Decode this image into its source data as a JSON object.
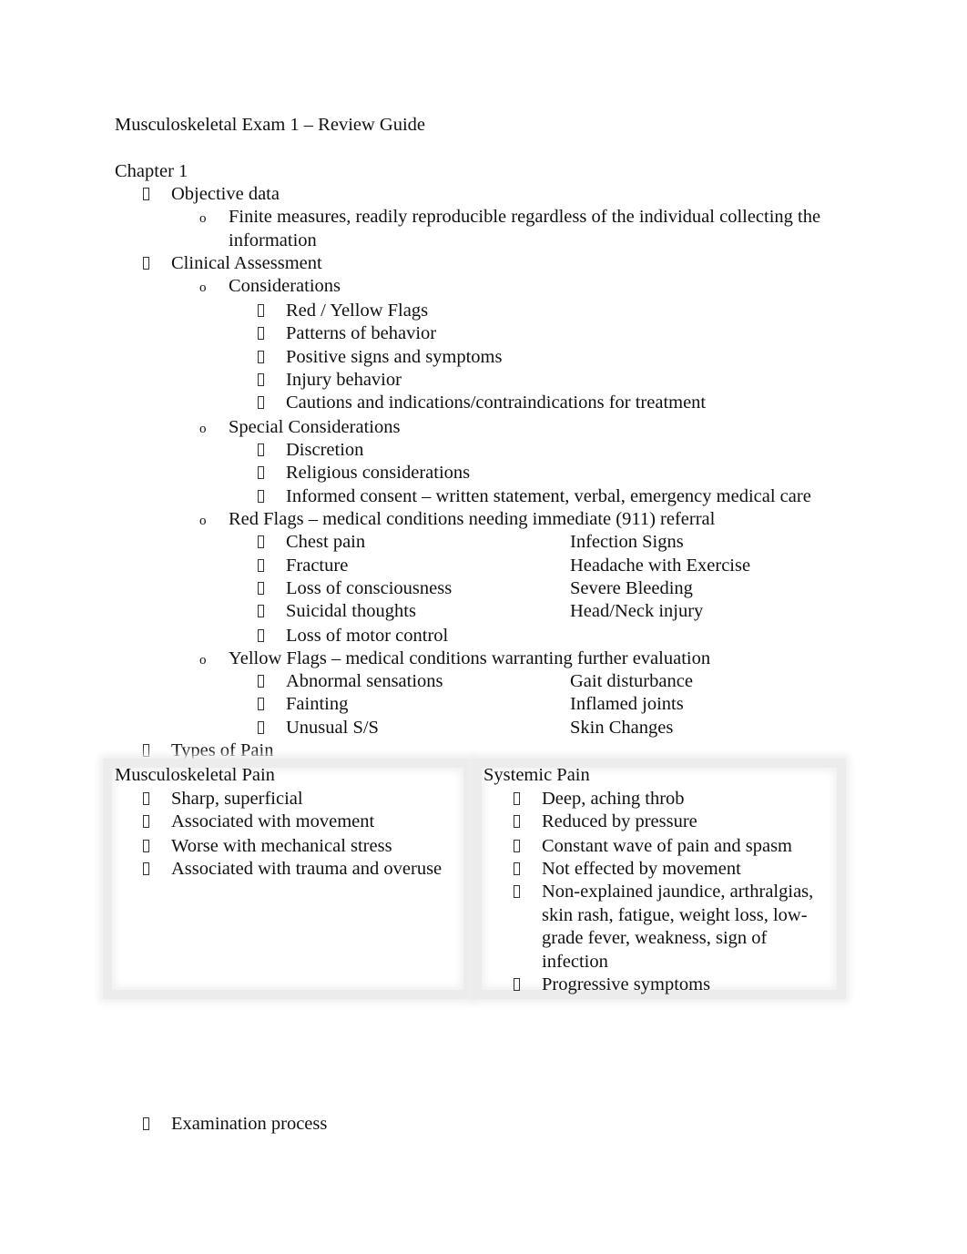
{
  "document": {
    "title": "Musculoskeletal Exam 1 – Review Guide",
    "chapter": "Chapter 1",
    "sections": {
      "objective_data": {
        "label": "Objective data",
        "sub": "Finite measures, readily reproducible regardless of the individual collecting the",
        "sub_cont": "information"
      },
      "clinical_assessment": {
        "label": "Clinical Assessment",
        "considerations": {
          "label": "Considerations",
          "items": [
            "Red / Yellow Flags",
            "Patterns of behavior",
            "Positive signs and symptoms",
            "Injury behavior",
            "Cautions and indications/contraindications for treatment"
          ]
        },
        "special_considerations": {
          "label": "Special Considerations",
          "items": [
            "Discretion",
            "Religious considerations",
            "Informed consent – written statement, verbal, emergency medical care"
          ]
        },
        "red_flags": {
          "label": "Red Flags – medical conditions needing immediate (911) referral",
          "left": [
            "Chest pain",
            "Fracture",
            "Loss of consciousness",
            "Suicidal thoughts",
            "Loss of motor control"
          ],
          "right": [
            "Infection Signs",
            "Headache with Exercise",
            "Severe Bleeding",
            "Head/Neck injury"
          ]
        },
        "yellow_flags": {
          "label": "Yellow Flags – medical conditions warranting further evaluation",
          "left": [
            "Abnormal sensations",
            "Fainting",
            "Unusual S/S"
          ],
          "right": [
            "Gait disturbance",
            "Inflamed joints",
            "Skin Changes"
          ]
        }
      },
      "types_of_pain": {
        "label": "Types of Pain",
        "table": {
          "musculoskeletal": {
            "header": "Musculoskeletal Pain",
            "items": [
              "Sharp, superficial",
              "Associated with movement",
              "Worse with mechanical stress",
              "Associated with trauma and overuse"
            ]
          },
          "systemic": {
            "header": "Systemic Pain",
            "items": [
              "Deep, aching throb",
              "Reduced by pressure",
              "Constant wave of pain and spasm",
              "Not effected by movement"
            ],
            "long_item_lines": [
              "Non-explained jaundice, arthralgias,",
              "skin rash, fatigue, weight loss, low-",
              "grade fever, weakness, sign of",
              "infection"
            ],
            "last_item": "Progressive symptoms"
          }
        }
      },
      "examination_process": {
        "label": "Examination process"
      }
    }
  }
}
